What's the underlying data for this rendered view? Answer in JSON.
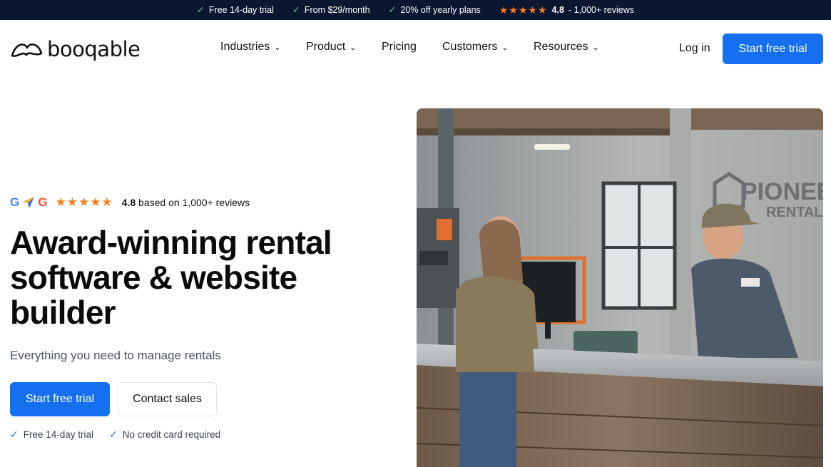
{
  "topbar": {
    "items": [
      {
        "text": "Free 14-day trial"
      },
      {
        "text": "From $29/month"
      },
      {
        "text": "20% off yearly plans"
      }
    ],
    "rating_value": "4.8",
    "rating_text": "- 1,000+ reviews"
  },
  "nav": {
    "logo_text": "booqable",
    "menu": [
      "Industries",
      "Product",
      "Pricing",
      "Customers",
      "Resources"
    ],
    "login": "Log in",
    "cta": "Start free trial"
  },
  "hero": {
    "rating_value": "4.8",
    "rating_text": "based on 1,000+ reviews",
    "headline": [
      "Award-winning rental",
      "software & website",
      "builder"
    ],
    "subhead": "Everything you need to manage rentals",
    "primary_button": "Start free trial",
    "secondary_button": "Contact sales",
    "perks": [
      "Free 14-day trial",
      "No credit card required"
    ],
    "image_sign": [
      "PIONEE",
      "RENTALS"
    ]
  },
  "colors": {
    "accent": "#1570ef",
    "topbar_bg": "#0b1630",
    "star": "#ff7a1a",
    "check_green": "#3ddc84"
  }
}
